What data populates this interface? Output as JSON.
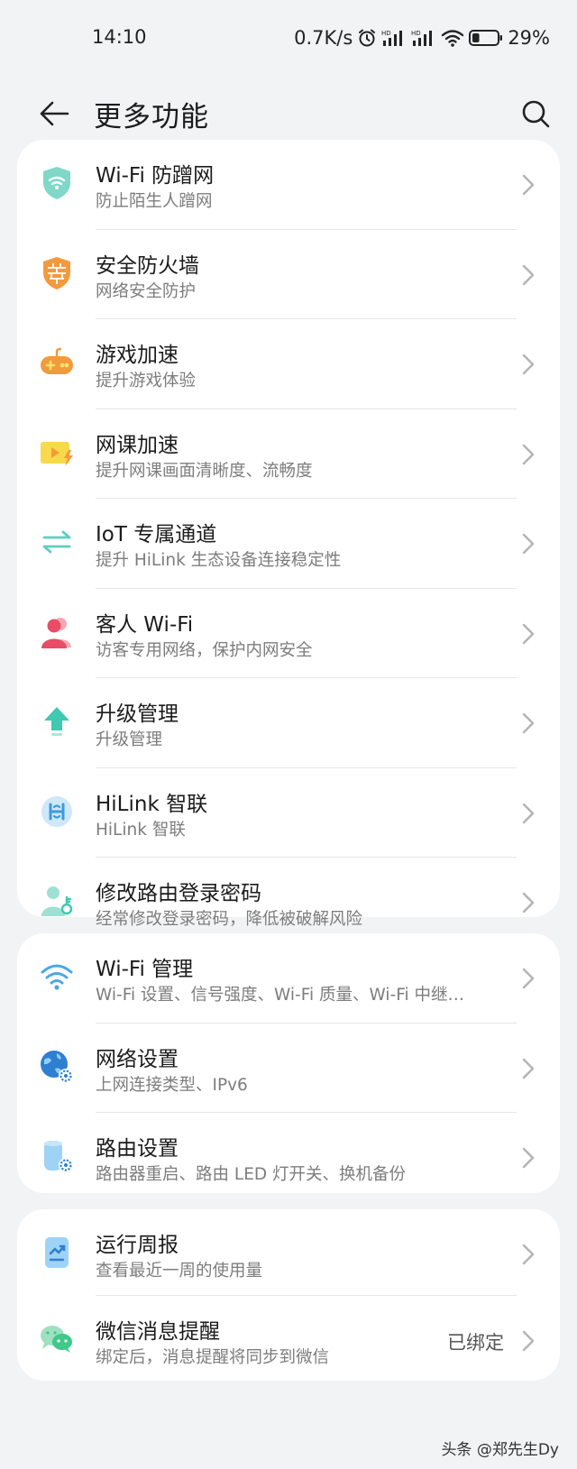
{
  "status_bar": {
    "time": "14:10",
    "speed": "0.7K/s",
    "battery": "29%",
    "battery_level": 0.29,
    "icons": [
      "alarm-icon",
      "hd-signal-icon",
      "hd-signal-icon",
      "wifi-icon",
      "battery-icon"
    ]
  },
  "header": {
    "back_icon": "arrow-left-icon",
    "title": "更多功能",
    "search_icon": "search-icon"
  },
  "section1": [
    {
      "title": "Wi-Fi 防蹭网",
      "subtitle": "防止陌生人蹭网",
      "icon": "shield-wifi-icon"
    },
    {
      "title": "安全防火墙",
      "subtitle": "网络安全防护",
      "icon": "firewall-icon"
    },
    {
      "title": "游戏加速",
      "subtitle": "提升游戏体验",
      "icon": "gamepad-icon"
    },
    {
      "title": "网课加速",
      "subtitle": "提升网课画面清晰度、流畅度",
      "icon": "video-bolt-icon"
    },
    {
      "title": "IoT 专属通道",
      "subtitle": "提升 HiLink 生态设备连接稳定性",
      "icon": "swap-arrows-icon"
    },
    {
      "title": "客人 Wi-Fi",
      "subtitle": "访客专用网络，保护内网安全",
      "icon": "guest-icon"
    },
    {
      "title": "升级管理",
      "subtitle": "升级管理",
      "icon": "upgrade-icon"
    },
    {
      "title": "HiLink 智联",
      "subtitle": "HiLink 智联",
      "icon": "hilink-icon"
    },
    {
      "title": "修改路由登录密码",
      "subtitle": "经常修改登录密码，降低被破解风险",
      "icon": "user-key-icon"
    }
  ],
  "section2": [
    {
      "title": "Wi-Fi 管理",
      "subtitle": "Wi-Fi 设置、信号强度、Wi-Fi 质量、Wi-Fi 中继…",
      "icon": "wifi-manage-icon"
    },
    {
      "title": "网络设置",
      "subtitle": "上网连接类型、IPv6",
      "icon": "globe-gear-icon"
    },
    {
      "title": "路由设置",
      "subtitle": "路由器重启、路由 LED 灯开关、换机备份",
      "icon": "router-gear-icon"
    }
  ],
  "section3": [
    {
      "title": "运行周报",
      "subtitle": "查看最近一周的使用量",
      "icon": "report-icon"
    },
    {
      "title": "微信消息提醒",
      "subtitle": "绑定后，消息提醒将同步到微信",
      "icon": "wechat-icon",
      "value": "已绑定"
    }
  ],
  "watermark": "头条 @郑先生Dy"
}
